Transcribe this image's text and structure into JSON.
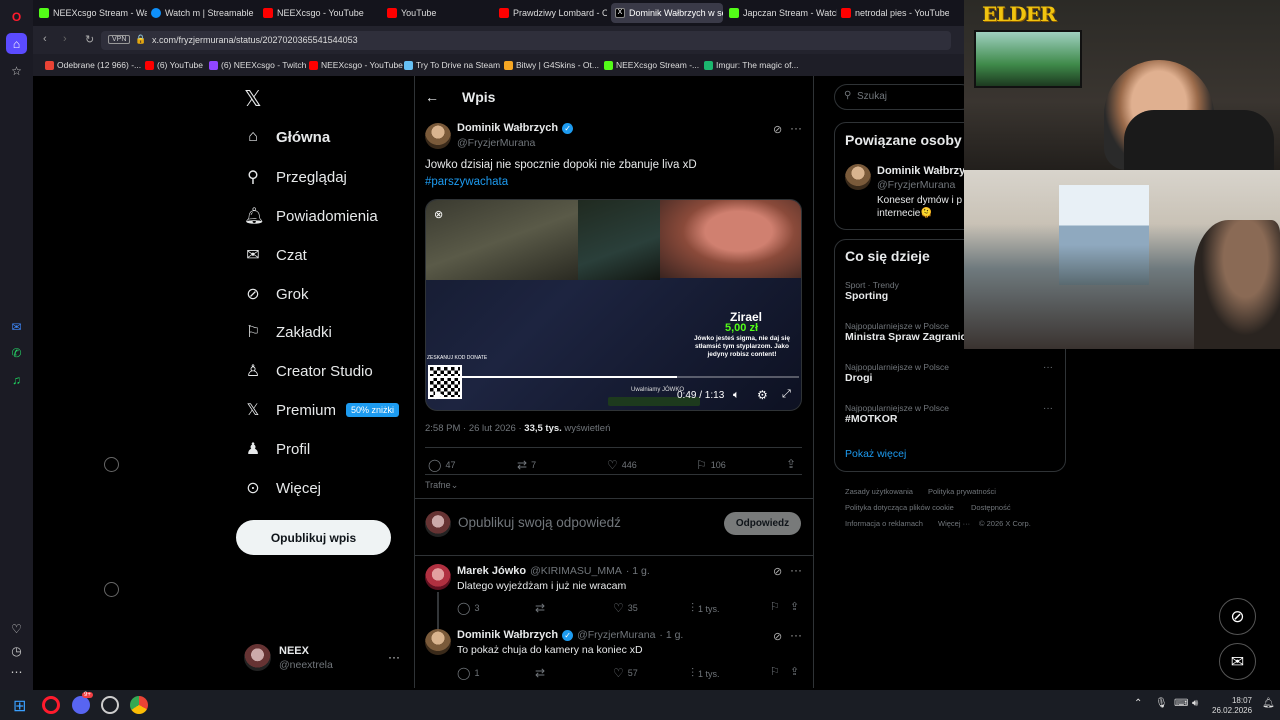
{
  "browser": {
    "tabs": [
      {
        "label": "NEEXcsgo Stream - Watch",
        "color": "#53fc18"
      },
      {
        "label": "Watch m | Streamable",
        "color": "#0f90fa"
      },
      {
        "label": "NEEXcsgo - YouTube",
        "color": "#ff0000"
      },
      {
        "label": "YouTube",
        "color": "#ff0000"
      },
      {
        "label": "Prawdziwy Lombard - Od",
        "color": "#ff0000"
      },
      {
        "label": "Dominik Wałbrzych w ser",
        "color": "#ffffff"
      },
      {
        "label": "Japczan Stream - Watch L",
        "color": "#53fc18"
      },
      {
        "label": "netrodal pies - YouTube",
        "color": "#ff0000"
      }
    ],
    "vpn_label": "VPN",
    "url": "x.com/fryzjermurana/status/2027020365541544053",
    "bookmarks": [
      {
        "label": "Odebrane (12 966) -...",
        "color": "#ea4335"
      },
      {
        "label": "(6) YouTube",
        "color": "#ff0000"
      },
      {
        "label": "(6) NEEXcsgo - Twitch",
        "color": "#9146ff"
      },
      {
        "label": "NEEXcsgo - YouTube",
        "color": "#ff0000"
      },
      {
        "label": "Try To Drive na Steam",
        "color": "#66c0f4"
      },
      {
        "label": "Bitwy | G4Skins - Ot...",
        "color": "#f5a623"
      },
      {
        "label": "NEEXcsgo Stream -...",
        "color": "#53fc18"
      },
      {
        "label": "Imgur: The magic of...",
        "color": "#1bb76e"
      }
    ]
  },
  "nav": {
    "logo": "𝕏",
    "items": [
      {
        "label": "Główna",
        "icon": "home-icon"
      },
      {
        "label": "Przeglądaj",
        "icon": "search-icon"
      },
      {
        "label": "Powiadomienia",
        "icon": "bell-icon"
      },
      {
        "label": "Czat",
        "icon": "mail-icon"
      },
      {
        "label": "Grok",
        "icon": "grok-icon"
      },
      {
        "label": "Zakładki",
        "icon": "bookmark-icon"
      },
      {
        "label": "Creator Studio",
        "icon": "creator-icon"
      },
      {
        "label": "Premium",
        "icon": "x-icon"
      },
      {
        "label": "Profil",
        "icon": "person-icon"
      },
      {
        "label": "Więcej",
        "icon": "more-icon"
      }
    ],
    "premium_badge": "50% zniżki",
    "post_button": "Opublikuj wpis",
    "account": {
      "name": "NEEX",
      "handle": "@neextrela",
      "more": "···"
    }
  },
  "header": {
    "back": "←",
    "title": "Wpis"
  },
  "tweet": {
    "name": "Dominik Wałbrzych",
    "handle": "@FryzjerMurana",
    "text": "Jowko dzisiaj nie spocznie dopoki nie zbanuje liva xD",
    "hashtag": "#parszywachata",
    "video": {
      "donor": "Zirael",
      "amount": "5,00 zł",
      "message": "Jówko jesteś sigma, nie daj się stłamsić tym styplarzom. Jako jedyny robisz content!",
      "qr_label": "ZESKANUJ KOD DONATE",
      "banner": "Uwalniamy JÓWKO",
      "time": "0:49 / 1:13",
      "progress": 0.67
    },
    "time": "2:58 PM · 26 lut 2026 ·",
    "views_count": "33,5 tys.",
    "views_label": "wyświetleń",
    "replies": "47",
    "retweets": "7",
    "likes": "446",
    "bookmarks": "106",
    "sort": "Trafne"
  },
  "composer": {
    "placeholder": "Opublikuj swoją odpowiedź",
    "button": "Odpowiedz"
  },
  "replies": [
    {
      "name": "Marek Jówko",
      "handle": "@KIRIMASU_MMA",
      "time": "· 1 g.",
      "text": "Dlatego wyjeżdżam i już nie wracam",
      "replies": "3",
      "retweets": "",
      "likes": "35",
      "views": "1 tys.",
      "verified": false
    },
    {
      "name": "Dominik Wałbrzych",
      "handle": "@FryzjerMurana",
      "time": "· 1 g.",
      "text": "To pokaż chuja do kamery na koniec xD",
      "replies": "1",
      "retweets": "",
      "likes": "57",
      "views": "1 tys.",
      "verified": true
    }
  ],
  "sidebar": {
    "search_placeholder": "Szukaj",
    "related_title": "Powiązane osoby",
    "related": {
      "name": "Dominik Wałbrzy...",
      "handle": "@FryzjerMurana",
      "bio": "Koneser dymów i p",
      "bio2": "internecie🫠"
    },
    "trends_title": "Co się dzieje",
    "trends": [
      {
        "meta": "Sport · Trendy",
        "name": "Sporting"
      },
      {
        "meta": "Najpopularniejsze w Polsce",
        "name": "Ministra Spraw Zagranic"
      },
      {
        "meta": "Najpopularniejsze w Polsce",
        "name": "Drogi"
      },
      {
        "meta": "Najpopularniejsze w Polsce",
        "name": "#MOTKOR"
      }
    ],
    "show_more": "Pokaż więcej",
    "footer": [
      "Zasady użytkowania",
      "Polityka prywatności",
      "Polityka dotycząca plików cookie",
      "Dostępność",
      "Informacja o reklamach",
      "Więcej ···",
      "© 2026 X Corp."
    ]
  },
  "overlay": {
    "logo_text": "ELDER"
  },
  "taskbar": {
    "time": "18:07",
    "date": "26.02.2026",
    "discord_badge": "9+"
  }
}
